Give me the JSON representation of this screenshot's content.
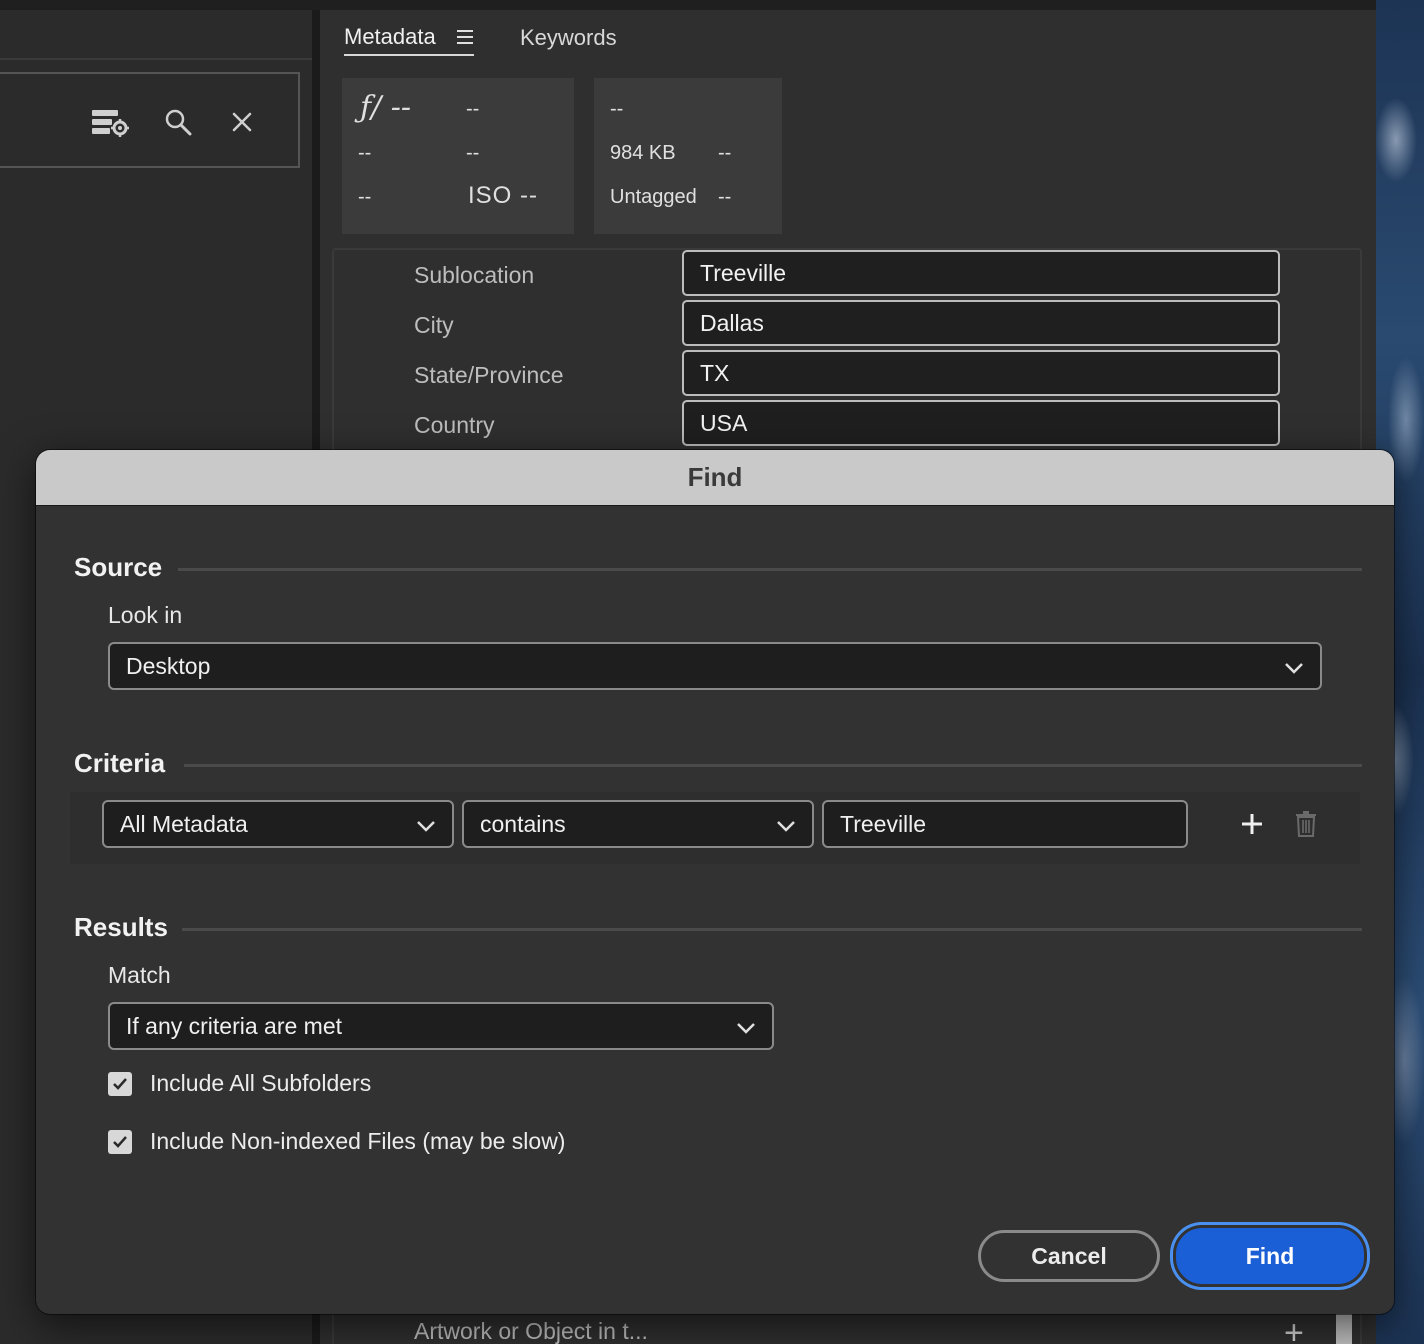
{
  "panel": {
    "tabs": [
      {
        "label": "Metadata"
      },
      {
        "label": "Keywords"
      }
    ],
    "camera_info": {
      "aperture": "ƒ/ --",
      "r1c2": "--",
      "r2c1": "--",
      "r2c2": "--",
      "r3c1": "--",
      "iso": "ISO --"
    },
    "file_info": {
      "r1c1": "--",
      "size": "984 KB",
      "r2c2": "--",
      "color_profile": "Untagged",
      "r3c2": "--"
    },
    "fields": [
      {
        "label": "Sublocation",
        "value": "Treeville"
      },
      {
        "label": "City",
        "value": "Dallas"
      },
      {
        "label": "State/Province",
        "value": "TX"
      },
      {
        "label": "Country",
        "value": "USA"
      }
    ],
    "bottom_row_label": "Artwork or Object in t..."
  },
  "dialog": {
    "title": "Find",
    "source": {
      "heading": "Source",
      "look_in_label": "Look in",
      "look_in_value": "Desktop"
    },
    "criteria": {
      "heading": "Criteria",
      "field": "All Metadata",
      "operator": "contains",
      "value": "Treeville"
    },
    "results": {
      "heading": "Results",
      "match_label": "Match",
      "match_value": "If any criteria are met",
      "include_subfolders": "Include All Subfolders",
      "include_nonindexed": "Include Non-indexed Files (may be slow)"
    },
    "buttons": {
      "cancel": "Cancel",
      "find": "Find"
    }
  },
  "colors": {
    "accent": "#1a5fd6",
    "focus_ring": "#4a90f0",
    "dialog_bg": "#323232",
    "titlebar_bg": "#c9c9c9"
  }
}
